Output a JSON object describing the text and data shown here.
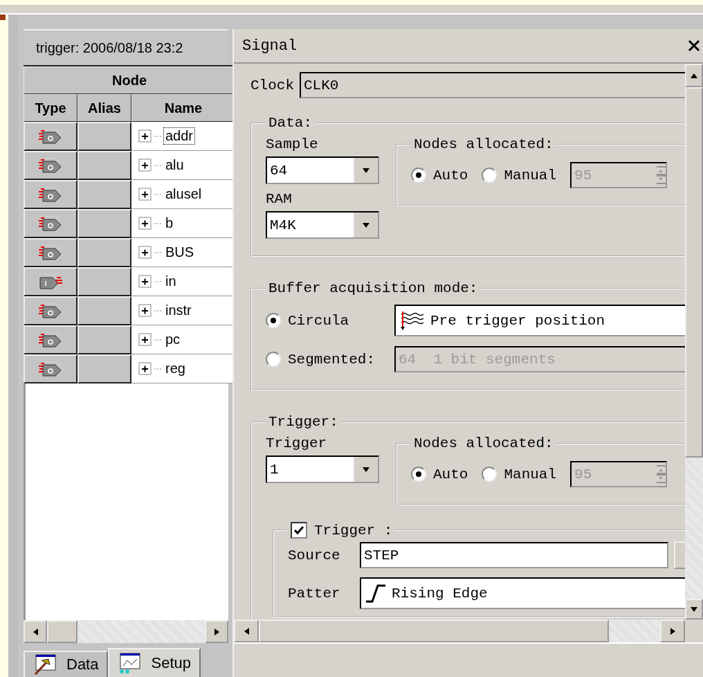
{
  "left_panel": {
    "header": "trigger: 2006/08/18 23:2",
    "table": {
      "group_header": "Node",
      "columns": [
        "Type",
        "Alias",
        "Name"
      ],
      "rows": [
        {
          "kind": "output",
          "name": "addr",
          "focused": true,
          "expanded": false
        },
        {
          "kind": "output",
          "name": "alu",
          "focused": false,
          "expanded": false
        },
        {
          "kind": "output",
          "name": "alusel",
          "focused": false,
          "expanded": false
        },
        {
          "kind": "output",
          "name": "b",
          "focused": false,
          "expanded": false
        },
        {
          "kind": "output",
          "name": "BUS",
          "focused": false,
          "expanded": false
        },
        {
          "kind": "input",
          "name": "in",
          "focused": false,
          "expanded": false
        },
        {
          "kind": "output",
          "name": "instr",
          "focused": false,
          "expanded": false
        },
        {
          "kind": "output",
          "name": "pc",
          "focused": false,
          "expanded": false
        },
        {
          "kind": "output",
          "name": "reg",
          "focused": false,
          "expanded": false
        }
      ]
    }
  },
  "tabs": [
    {
      "label": "Data",
      "selected": false
    },
    {
      "label": "Setup",
      "selected": true
    }
  ],
  "signal_panel": {
    "title": "Signal",
    "clock": {
      "label": "Clock",
      "value": "CLK0"
    },
    "data": {
      "legend": "Data:",
      "sample": {
        "label": "Sample",
        "value": "64"
      },
      "ram": {
        "label": "RAM",
        "value": "M4K"
      },
      "nodes": {
        "legend": "Nodes allocated:",
        "options": [
          {
            "label": "Auto",
            "selected": true
          },
          {
            "label": "Manual",
            "selected": false
          }
        ],
        "count": {
          "value": "95",
          "disabled": true
        }
      }
    },
    "buffer": {
      "legend": "Buffer acquisition mode:",
      "modes": [
        {
          "label": "Circula",
          "selected": true,
          "field": "Pre trigger position",
          "field_disabled": false
        },
        {
          "label": "Segmented:",
          "selected": false,
          "field": "64  1 bit segments",
          "field_disabled": true
        }
      ]
    },
    "trigger": {
      "legend": "Trigger:",
      "count": {
        "label": "Trigger",
        "value": "1"
      },
      "nodes": {
        "legend": "Nodes allocated:",
        "options": [
          {
            "label": "Auto",
            "selected": true
          },
          {
            "label": "Manual",
            "selected": false
          }
        ],
        "count": {
          "value": "95",
          "disabled": true
        }
      },
      "condition": {
        "label": "Trigger :",
        "checked": true,
        "source": {
          "label": "Source",
          "value": "STEP"
        },
        "pattern": {
          "label": "Patter",
          "value": "Rising Edge"
        }
      }
    }
  }
}
